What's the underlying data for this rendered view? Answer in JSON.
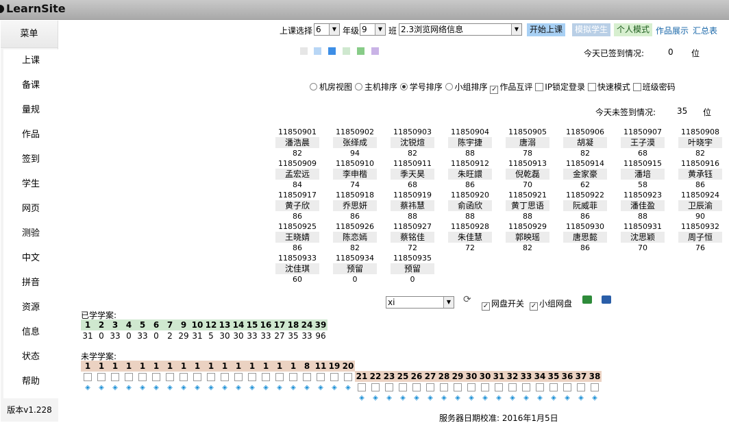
{
  "app": {
    "title": "LearnSite",
    "version": "版本v1.228"
  },
  "sidebar": {
    "header": "菜单",
    "items": [
      "上课",
      "备课",
      "量规",
      "作品",
      "签到",
      "学生",
      "网页",
      "测验",
      "中文",
      "拼音",
      "资源",
      "信息",
      "状态",
      "帮助"
    ]
  },
  "controls": {
    "lesson_label": "上课选择",
    "lesson_value": "6",
    "grade_label": "年级",
    "grade_value": "9",
    "class_label": "班",
    "course_value": "2.3浏览网络信息",
    "start_button": "开始上课",
    "mock_button": "模拟学生",
    "personal_mode": "个人模式",
    "works_show": "作品展示",
    "summary": "汇总表"
  },
  "signin": {
    "label": "今天已签到情况:",
    "count": "0",
    "unit": "位"
  },
  "unsigned": {
    "label": "今天未签到情况:",
    "count": "35",
    "unit": "位"
  },
  "palette": [
    "#e6e6e6",
    "#b8d6f5",
    "#3d8ee6",
    "#cfe8cf",
    "#88cc88",
    "#c9b3e6"
  ],
  "options": {
    "radios": [
      {
        "label": "机房视图",
        "on": false
      },
      {
        "label": "主机排序",
        "on": false
      },
      {
        "label": "学号排序",
        "on": true
      },
      {
        "label": "小组排序",
        "on": false
      }
    ],
    "checks": [
      {
        "label": "作品互评",
        "on": true
      },
      {
        "label": "IP锁定登录",
        "on": false
      },
      {
        "label": "快速模式",
        "on": false
      },
      {
        "label": "班级密码",
        "on": false
      }
    ]
  },
  "students": [
    {
      "id": "11850901",
      "name": "潘浩晨",
      "score": "82"
    },
    {
      "id": "11850902",
      "name": "张绎成",
      "score": "94"
    },
    {
      "id": "11850903",
      "name": "沈锐煊",
      "score": "82"
    },
    {
      "id": "11850904",
      "name": "陈宇捷",
      "score": "88"
    },
    {
      "id": "11850905",
      "name": "唐溺",
      "score": "78"
    },
    {
      "id": "11850906",
      "name": "胡凝",
      "score": "82"
    },
    {
      "id": "11850907",
      "name": "王子漠",
      "score": "68"
    },
    {
      "id": "11850908",
      "name": "叶晓宇",
      "score": "82"
    },
    {
      "id": "11850909",
      "name": "孟宏远",
      "score": "84"
    },
    {
      "id": "11850910",
      "name": "李申楷",
      "score": "74"
    },
    {
      "id": "11850911",
      "name": "季天昊",
      "score": "68"
    },
    {
      "id": "11850912",
      "name": "朱旺譞",
      "score": "86"
    },
    {
      "id": "11850913",
      "name": "倪乾磊",
      "score": "70"
    },
    {
      "id": "11850914",
      "name": "金家豪",
      "score": "62"
    },
    {
      "id": "11850915",
      "name": "潘培",
      "score": "58"
    },
    {
      "id": "11850916",
      "name": "黄承钰",
      "score": "86"
    },
    {
      "id": "11850917",
      "name": "黄子欣",
      "score": "86"
    },
    {
      "id": "11850918",
      "name": "乔思妍",
      "score": "86"
    },
    {
      "id": "11850919",
      "name": "蔡祎慧",
      "score": "88"
    },
    {
      "id": "11850920",
      "name": "俞函欣",
      "score": "88"
    },
    {
      "id": "11850921",
      "name": "黄丁思语",
      "score": "88"
    },
    {
      "id": "11850922",
      "name": "阮威菲",
      "score": "86"
    },
    {
      "id": "11850923",
      "name": "潘佳盈",
      "score": "88"
    },
    {
      "id": "11850924",
      "name": "卫辰渝",
      "score": "90"
    },
    {
      "id": "11850925",
      "name": "王晓婧",
      "score": "86"
    },
    {
      "id": "11850926",
      "name": "陈恋嫣",
      "score": "82"
    },
    {
      "id": "11850927",
      "name": "蔡铭佳",
      "score": "72"
    },
    {
      "id": "11850928",
      "name": "朱佳慧",
      "score": "72"
    },
    {
      "id": "11850929",
      "name": "郭映瑶",
      "score": "82"
    },
    {
      "id": "11850930",
      "name": "唐思懿",
      "score": "86"
    },
    {
      "id": "11850931",
      "name": "沈思颖",
      "score": "70"
    },
    {
      "id": "11850932",
      "name": "周子恒",
      "score": "76"
    },
    {
      "id": "11850933",
      "name": "沈佳琪",
      "score": "60"
    },
    {
      "id": "11850934",
      "name": "预留",
      "score": "0"
    },
    {
      "id": "11850935",
      "name": "预留",
      "score": "0"
    }
  ],
  "disk": {
    "select_value": "xi",
    "disk_switch": "网盘开关",
    "group_disk": "小组网盘"
  },
  "learned": {
    "label": "已学学案:",
    "cases": [
      "1",
      "2",
      "3",
      "4",
      "5",
      "6",
      "7",
      "9",
      "10",
      "12",
      "13",
      "14",
      "15",
      "16",
      "17",
      "18",
      "24",
      "39"
    ],
    "counts": [
      "31",
      "0",
      "33",
      "0",
      "33",
      "0",
      "2",
      "29",
      "31",
      "5",
      "30",
      "30",
      "33",
      "33",
      "27",
      "35",
      "33",
      "96"
    ]
  },
  "unlearned": {
    "label": "未学学案:",
    "row1": [
      "1",
      "1",
      "1",
      "1",
      "1",
      "1",
      "1",
      "1",
      "1",
      "1",
      "1",
      "1",
      "1",
      "1",
      "1",
      "1",
      "8",
      "11",
      "19",
      "20"
    ],
    "row2": [
      "21",
      "22",
      "23",
      "25",
      "26",
      "27",
      "28",
      "29",
      "30",
      "30",
      "31",
      "32",
      "33",
      "34",
      "35",
      "36",
      "37",
      "38"
    ]
  },
  "footer": {
    "server_date": "服务器日期校准: 2016年1月5日"
  }
}
